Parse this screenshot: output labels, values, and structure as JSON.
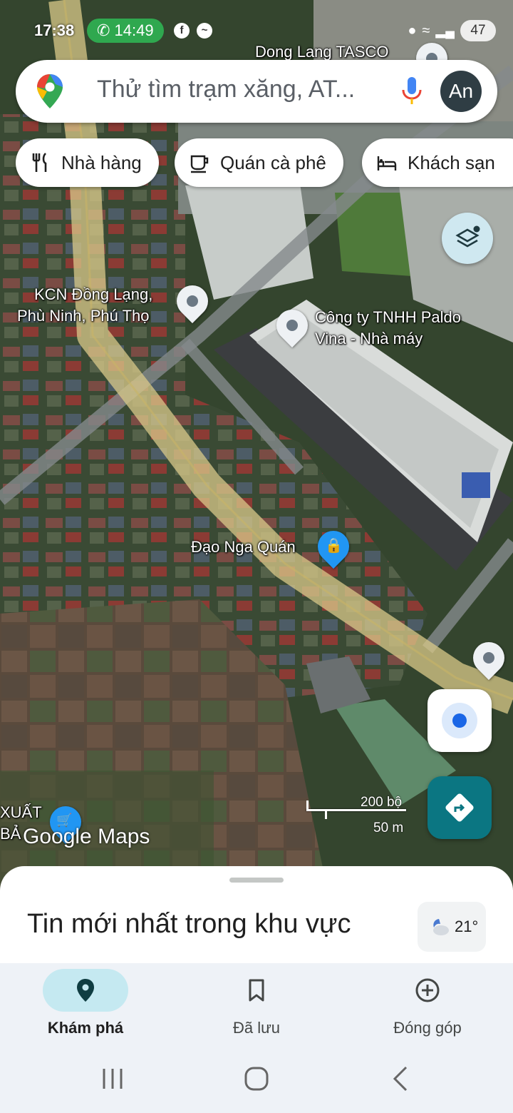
{
  "status_bar": {
    "time": "17:38",
    "call_timer": "14:49",
    "battery": "47"
  },
  "search": {
    "placeholder": "Thử tìm trạm xăng, AT...",
    "avatar_initials": "An"
  },
  "chips": [
    {
      "label": "Nhà hàng",
      "icon": "restaurant-icon"
    },
    {
      "label": "Quán cà phê",
      "icon": "coffee-icon"
    },
    {
      "label": "Khách sạn",
      "icon": "hotel-icon"
    }
  ],
  "map": {
    "labels": {
      "tasco": "Dong Lang TASCO",
      "kcn_line1": "KCN Đồng Lạng,",
      "kcn_line2": "Phù Ninh, Phú Thọ",
      "paldo_line1": "Công ty TNHH Paldo",
      "paldo_line2": "Vina - Nhà máy",
      "dao_nga": "Đạo Nga Quán",
      "xuat_line1": "XUẤT",
      "xuat_line2": "BẢ"
    },
    "scale_feet": "200 bộ",
    "scale_meters": "50 m",
    "brand": "Google Maps"
  },
  "sheet": {
    "title": "Tin mới nhất trong khu vực",
    "temperature": "21°"
  },
  "nav": {
    "explore": "Khám phá",
    "saved": "Đã lưu",
    "contribute": "Đóng góp"
  },
  "colors": {
    "road": "#d9c98a",
    "accent": "#0b7682",
    "active_tab": "#c5e9f1"
  }
}
